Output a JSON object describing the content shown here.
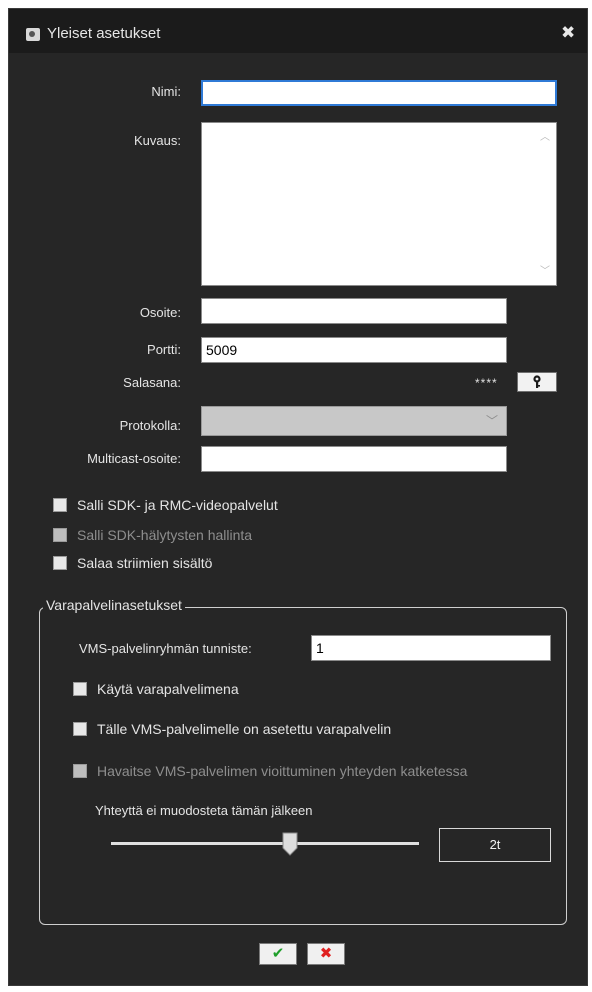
{
  "window": {
    "title": "Yleiset asetukset",
    "close_glyph": "✖"
  },
  "fields": {
    "name_label": "Nimi:",
    "name_value": "",
    "description_label": "Kuvaus:",
    "description_value": "",
    "address_label": "Osoite:",
    "address_value": "",
    "port_label": "Portti:",
    "port_value": "5009",
    "password_label": "Salasana:",
    "password_mask": "****",
    "protocol_label": "Protokolla:",
    "protocol_value": "",
    "multicast_label": "Multicast-osoite:",
    "multicast_value": ""
  },
  "checkboxes": [
    {
      "label": "Salli SDK- ja RMC-videopalvelut",
      "checked": false,
      "enabled": true
    },
    {
      "label": "Salli SDK-hälytysten hallinta",
      "checked": false,
      "enabled": false
    },
    {
      "label": "Salaa striimien sisältö",
      "checked": false,
      "enabled": true
    }
  ],
  "backup": {
    "group_title": "Varapalvelinasetukset",
    "group_id_label": "VMS-palvelinryhmän tunniste:",
    "group_id_value": "1",
    "options": [
      {
        "label": "Käytä varapalvelimena",
        "checked": false,
        "enabled": true
      },
      {
        "label": "Tälle VMS-palvelimelle on asetettu varapalvelin",
        "checked": false,
        "enabled": true
      },
      {
        "label": "Havaitse VMS-palvelimen vioittuminen yhteyden katketessa",
        "checked": false,
        "enabled": false
      }
    ],
    "timeout_label": "Yhteyttä ei muodosteta tämän jälkeen",
    "timeout_value": "2t",
    "slider_level": 0.58
  },
  "buttons": {
    "ok_glyph": "✔",
    "cancel_glyph": "✖"
  },
  "colors": {
    "ok": "#1e9e2a",
    "cancel": "#e02020",
    "focus": "#2f7ad6"
  },
  "icons": {
    "title": "settings-icon",
    "close": "close-icon",
    "password": "key-icon",
    "protocol": "chevron-down-icon",
    "ok": "checkmark-icon",
    "cancel": "cancel-icon"
  }
}
